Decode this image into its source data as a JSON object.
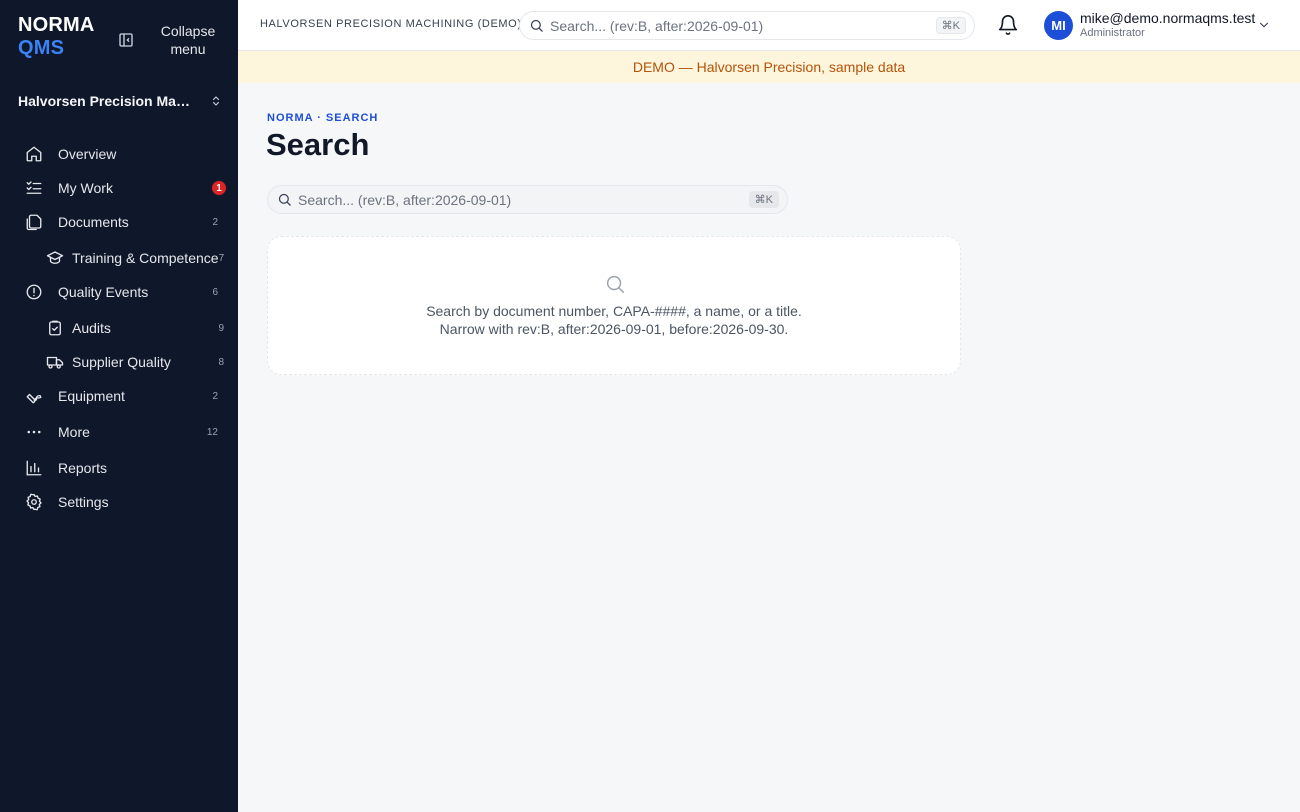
{
  "brand": {
    "line1": "NORMA",
    "line2": "QMS"
  },
  "sidebar": {
    "collapse_label": "Collapse menu",
    "org_name": "Halvorsen Precision Machi...",
    "items": [
      {
        "label": "Overview",
        "icon": "home-icon",
        "count": ""
      },
      {
        "label": "My Work",
        "icon": "checklist-icon",
        "badge": "1"
      },
      {
        "label": "Documents",
        "icon": "documents-icon",
        "count": "2"
      },
      {
        "label": "Training & Competence",
        "icon": "graduation-cap-icon",
        "count": "7"
      },
      {
        "label": "Quality Events",
        "icon": "alert-circle-icon",
        "count": "6"
      },
      {
        "label": "Audits",
        "icon": "clipboard-check-icon",
        "count": "9"
      },
      {
        "label": "Supplier Quality",
        "icon": "truck-icon",
        "count": "8"
      },
      {
        "label": "Equipment",
        "icon": "wrench-icon",
        "count": "2"
      },
      {
        "label": "More",
        "icon": "more-dots-icon",
        "count": "12"
      },
      {
        "label": "Reports",
        "icon": "bar-chart-icon",
        "count": ""
      },
      {
        "label": "Settings",
        "icon": "gear-icon",
        "count": ""
      }
    ]
  },
  "header": {
    "org_label": "HALVORSEN PRECISION MACHINING (DEMO)",
    "search_placeholder": "Search... (rev:B, after:2026-09-01)",
    "search_shortcut": "⌘K",
    "avatar_initials": "MI",
    "user_email": "mike@demo.normaqms.test",
    "user_role": "Administrator"
  },
  "banner": {
    "text": "DEMO — Halvorsen Precision, sample data"
  },
  "main": {
    "eyebrow": "NORMA · SEARCH",
    "title": "Search",
    "search_placeholder": "Search... (rev:B, after:2026-09-01)",
    "search_shortcut": "⌘K",
    "empty_line1": "Search by document number, CAPA-####, a name, or a title.",
    "empty_line2": "Narrow with rev:B, after:2026-09-01, before:2026-09-30."
  },
  "colors": {
    "sidebar_bg": "#0f172a",
    "accent": "#1d4ed8",
    "banner_bg": "#fdf6dd",
    "banner_text": "#b45309",
    "badge": "#dc2626"
  }
}
